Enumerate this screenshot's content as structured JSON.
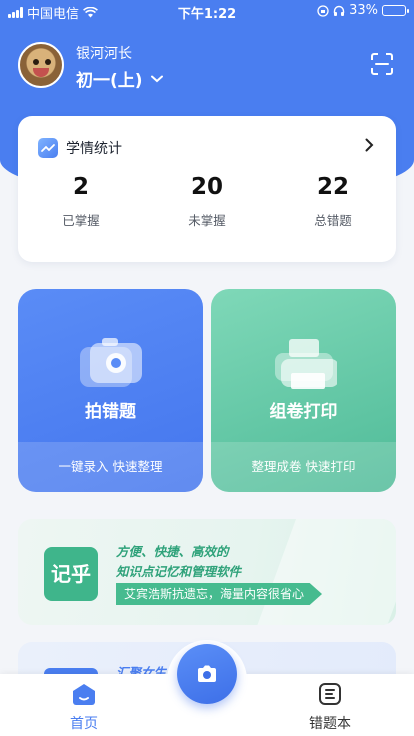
{
  "status_bar": {
    "carrier": "中国电信",
    "time": "下午1:22",
    "battery": "33%",
    "battery_level": 0.33
  },
  "profile": {
    "name": "银河河长",
    "grade": "初一(上)"
  },
  "stats": {
    "title": "学情统计",
    "items": [
      {
        "value": "2",
        "label": "已掌握"
      },
      {
        "value": "20",
        "label": "未掌握"
      },
      {
        "value": "22",
        "label": "总错题"
      }
    ]
  },
  "tiles": {
    "capture": {
      "title": "拍错题",
      "subtitle": "一键录入 快速整理"
    },
    "print": {
      "title": "组卷打印",
      "subtitle": "整理成卷 快速打印"
    }
  },
  "banner": {
    "logo": "记乎",
    "line1": "方便、快捷、高效的",
    "line2": "知识点记忆和管理软件",
    "tag": "艾宾浩斯抗遗忘，海量内容很省心"
  },
  "card2": {
    "text": "汇聚女生"
  },
  "tabbar": {
    "home": "首页",
    "mistakes": "错题本"
  },
  "colors": {
    "primary": "#4a7ef0",
    "green": "#4fbb98"
  },
  "icons": [
    "signal-icon",
    "wifi-icon",
    "lock-rotation-icon",
    "headphones-icon",
    "battery-icon",
    "chevron-down-icon",
    "scan-icon",
    "chart-icon",
    "chevron-right-icon",
    "camera-icon",
    "printer-icon",
    "home-icon",
    "notebook-icon"
  ]
}
